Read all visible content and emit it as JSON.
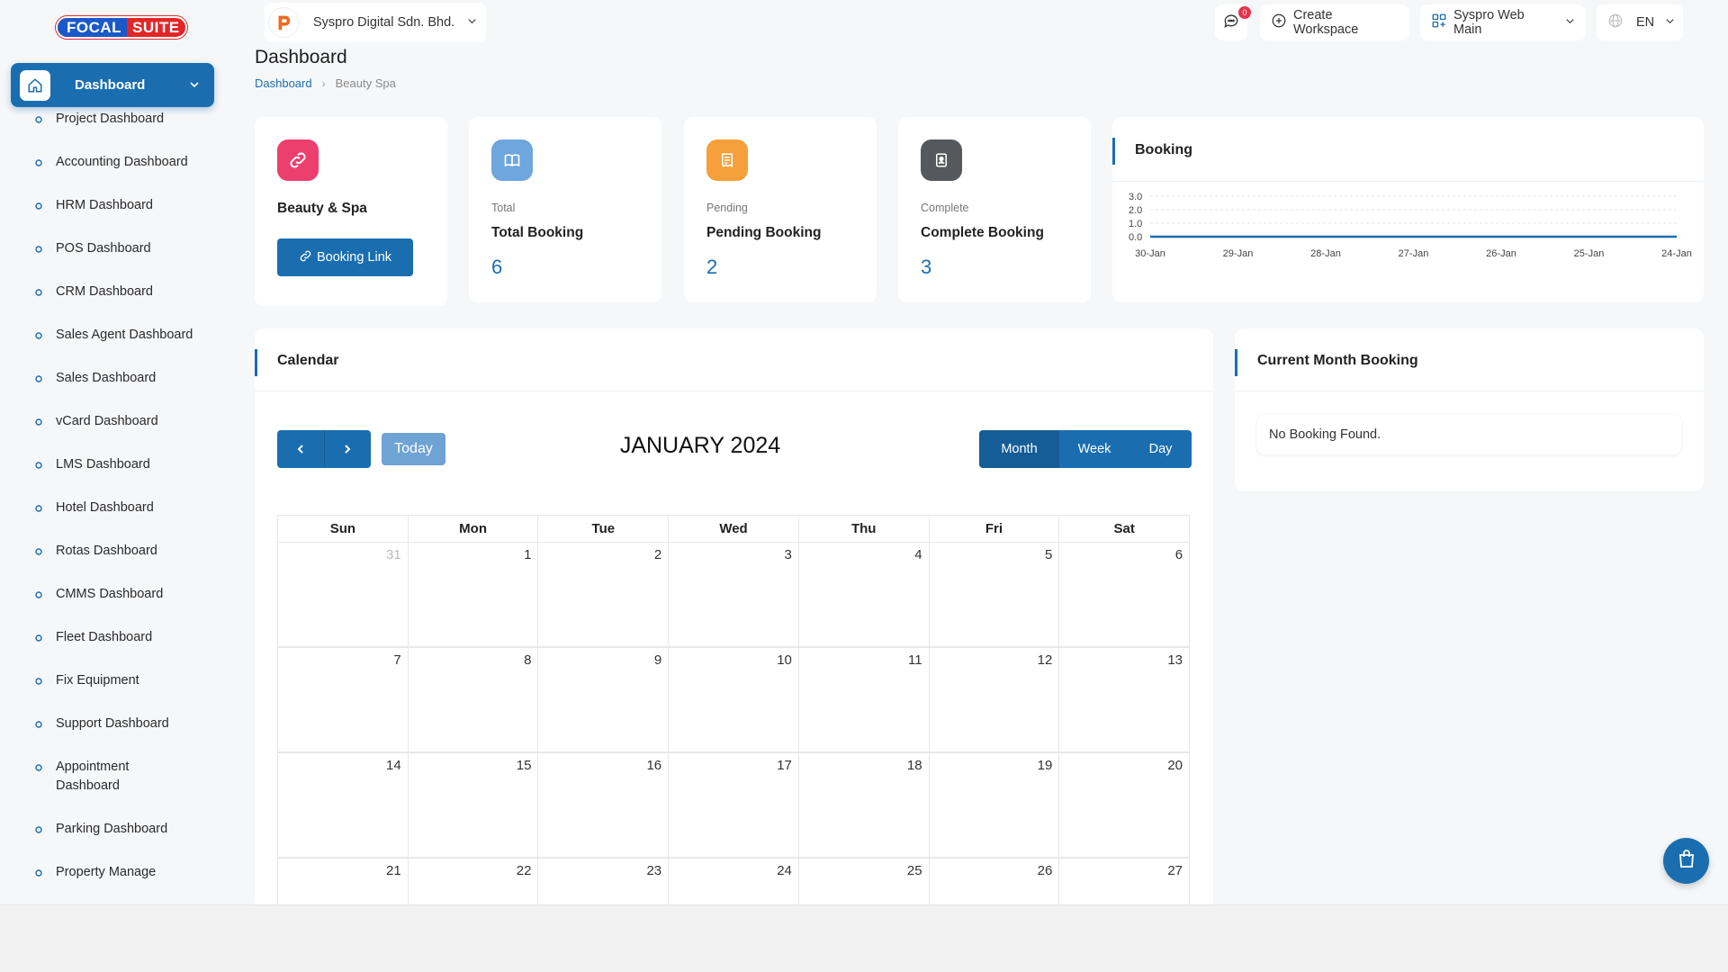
{
  "brand": {
    "part1": "FOCAL",
    "part2": "SUITE"
  },
  "sidebar": {
    "active": {
      "label": "Dashboard"
    },
    "items": [
      "Project Dashboard",
      "Accounting Dashboard",
      "HRM Dashboard",
      "POS Dashboard",
      "CRM Dashboard",
      "Sales Agent Dashboard",
      "Sales Dashboard",
      "vCard Dashboard",
      "LMS Dashboard",
      "Hotel Dashboard",
      "Rotas Dashboard",
      "CMMS Dashboard",
      "Fleet Dashboard",
      "Fix Equipment",
      "Support Dashboard",
      "Appointment Dashboard",
      "Parking Dashboard",
      "Property Manage"
    ]
  },
  "header": {
    "company": "Syspro Digital Sdn. Bhd.",
    "notification_count": "0",
    "create_workspace": "Create Workspace",
    "workspace": "Syspro Web Main",
    "language": "EN"
  },
  "page": {
    "title": "Dashboard",
    "breadcrumb": [
      "Dashboard",
      "Beauty Spa"
    ]
  },
  "cards": {
    "beauty": {
      "title": "Beauty & Spa",
      "button": "Booking Link"
    },
    "total": {
      "sub": "Total",
      "title": "Total Booking",
      "value": "6"
    },
    "pending": {
      "sub": "Pending",
      "title": "Pending Booking",
      "value": "2"
    },
    "complete": {
      "sub": "Complete",
      "title": "Complete Booking",
      "value": "3"
    }
  },
  "colors": {
    "accent": "#1a6eb0",
    "pink": "#ec3f6e",
    "light_blue": "#6ea6de",
    "orange": "#f5a03a",
    "gray": "#55585c"
  },
  "chart_data": {
    "type": "line",
    "title": "Booking",
    "categories": [
      "30-Jan",
      "29-Jan",
      "28-Jan",
      "27-Jan",
      "26-Jan",
      "25-Jan",
      "24-Jan"
    ],
    "series": [
      {
        "values": [
          0,
          0,
          0,
          0,
          0,
          0,
          0
        ]
      }
    ],
    "yticks": [
      "3.0",
      "2.0",
      "1.0",
      "0.0"
    ],
    "ylim": [
      0,
      3
    ],
    "grid": true
  },
  "calendar": {
    "title": "Calendar",
    "month_label": "JANUARY 2024",
    "today_label": "Today",
    "views": [
      "Month",
      "Week",
      "Day"
    ],
    "weekdays": [
      "Sun",
      "Mon",
      "Tue",
      "Wed",
      "Thu",
      "Fri",
      "Sat"
    ],
    "weeks": [
      [
        "31",
        "1",
        "2",
        "3",
        "4",
        "5",
        "6"
      ],
      [
        "7",
        "8",
        "9",
        "10",
        "11",
        "12",
        "13"
      ],
      [
        "14",
        "15",
        "16",
        "17",
        "18",
        "19",
        "20"
      ],
      [
        "21",
        "22",
        "23",
        "24",
        "25",
        "26",
        "27"
      ]
    ]
  },
  "current_month": {
    "title": "Current Month Booking",
    "empty": "No Booking Found."
  }
}
